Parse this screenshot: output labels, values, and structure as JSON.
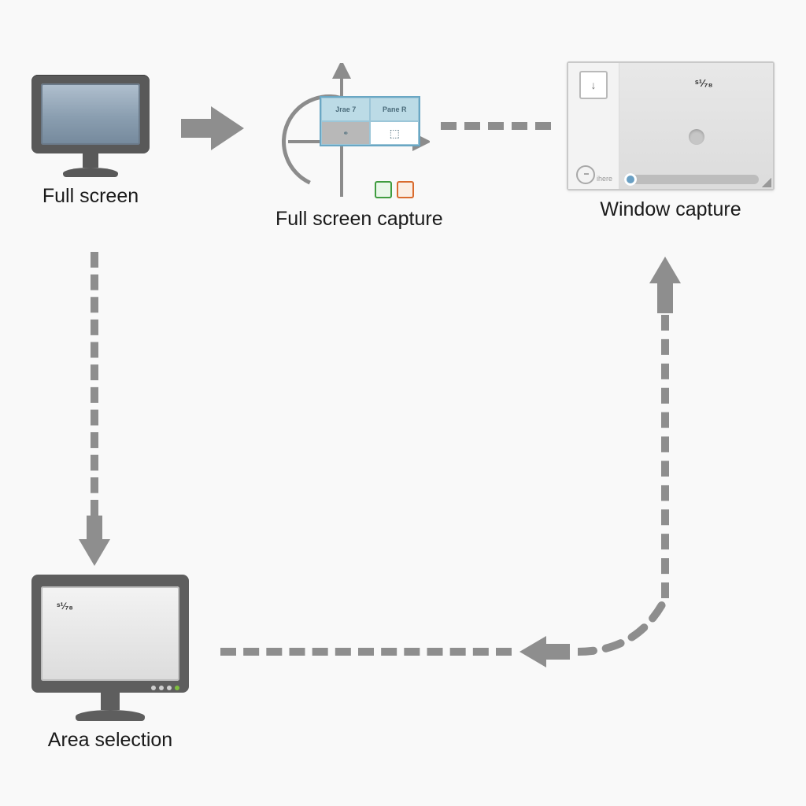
{
  "nodes": {
    "full_screen": {
      "label": "Full screen"
    },
    "full_screen_capture": {
      "label": "Full screen capture",
      "table_headers": [
        "Jrae  7",
        "Pane R"
      ],
      "cell_icon_left": "⚭",
      "cell_icon_right": "⬚"
    },
    "window_capture": {
      "label": "Window capture",
      "watermark": "ˢ¹⁄₇₈",
      "side_button_glyph": "↓",
      "side_small_text": "ihere"
    },
    "area_selection": {
      "label": "Area selection",
      "watermark": "ˢ¹⁄₇₈"
    }
  },
  "arrows": {
    "solid_right": "→",
    "dashed_right_to_window": "⇢",
    "dashed_down_to_area": "⇣",
    "curve_up_to_window": "↰",
    "dashed_left_to_area": "⇠"
  },
  "colors": {
    "arrow": "#8e8e8e",
    "bezel": "#595959",
    "accent": "#6aa7c4"
  }
}
